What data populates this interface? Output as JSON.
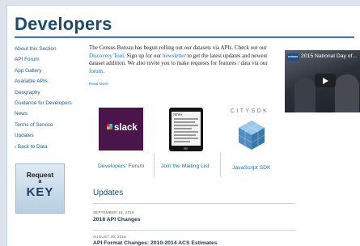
{
  "page": {
    "title": "Developers"
  },
  "sidebar": {
    "items": [
      {
        "label": "About this Section"
      },
      {
        "label": "API Forum"
      },
      {
        "label": "App Gallery"
      },
      {
        "label": "Available APIs"
      },
      {
        "label": "Geography"
      },
      {
        "label": "Guidance for Developers"
      },
      {
        "label": "News"
      },
      {
        "label": "Terms of Service"
      },
      {
        "label": "Updates"
      }
    ],
    "back_label": "Back to Data",
    "key_card": {
      "line1": "Request",
      "line2": "a",
      "line3": "KEY"
    }
  },
  "intro": {
    "part1": "The Census Bureau has begun rolling out our datasets via APIs.  Check out our ",
    "link1": "Discovery Tool",
    "part2": ". Sign up for our ",
    "link2": "newsletter",
    "part3": " to get the latest updates and newest dataset addition. We also invite you to make requests for features / data via our ",
    "link3": "forum",
    "part4": ".",
    "read_more": "Read More"
  },
  "video": {
    "logo": "census",
    "title": "2015 National Day of..."
  },
  "tiles": {
    "slack_text": "slack",
    "news_word": "NEWS",
    "citysdk_text": "CITYSDK",
    "forum_label": "Developers' Forum",
    "mailing_label": "Join the Mailing List",
    "sdk_label": "JavaScript SDK"
  },
  "updates": {
    "heading": "Updates",
    "items": [
      {
        "date": "SEPTEMBER 19, 2018",
        "title": "2018 API Changes"
      },
      {
        "date": "AUGUST 30, 2018",
        "title": "API Format Changes: 2010-2014 ACS Estimates"
      }
    ]
  },
  "colors": {
    "brand": "#1b4b6e",
    "link": "#1b6fa8",
    "rule": "#3e7bb6",
    "slack": "#4a154b"
  }
}
